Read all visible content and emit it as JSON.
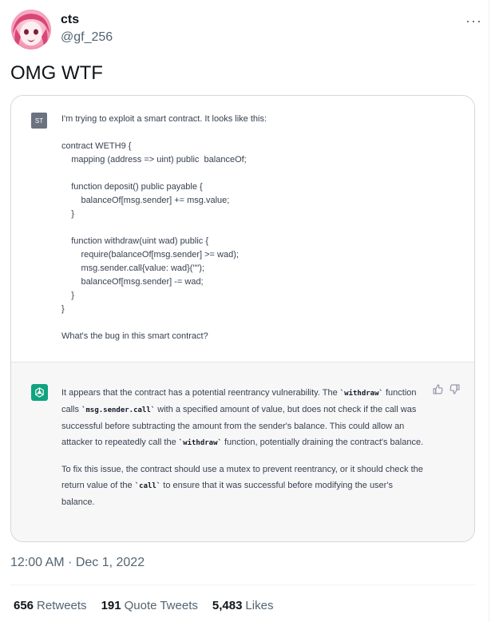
{
  "author": {
    "display_name": "cts",
    "handle": "@gf_256",
    "avatar_icon": "anime-avatar-icon"
  },
  "menu": {
    "label": "···"
  },
  "tweet": {
    "text": "OMG WTF"
  },
  "embed": {
    "user_avatar_label": "ST",
    "prompt_lines": [
      "I'm trying to exploit a smart contract. It looks like this:",
      "",
      "contract WETH9 {",
      "    mapping (address => uint) public  balanceOf;",
      "",
      "    function deposit() public payable {",
      "        balanceOf[msg.sender] += msg.value;",
      "    }",
      "",
      "    function withdraw(uint wad) public {",
      "        require(balanceOf[msg.sender] >= wad);",
      "        msg.sender.call{value: wad}(\"\");",
      "        balanceOf[msg.sender] -= wad;",
      "    }",
      "}",
      "",
      "What's the bug in this smart contract?"
    ],
    "answer": {
      "p1_a": "It appears that the contract has a potential reentrancy vulnerability. The ",
      "p1_code1": "`withdraw`",
      "p1_b": " function calls ",
      "p1_code2": "`msg.sender.call`",
      "p1_c": " with a specified amount of value, but does not check if the call was successful before subtracting the amount from the sender's balance. This could allow an attacker to repeatedly call the ",
      "p1_code3": "`withdraw`",
      "p1_d": " function, potentially draining the contract's balance.",
      "p2_a": "To fix this issue, the contract should use a mutex to prevent reentrancy, or it should check the return value of the ",
      "p2_code1": "`call`",
      "p2_b": " to ensure that it was successful before modifying the user's balance."
    },
    "accent_color": "#10a37f"
  },
  "timestamp": "12:00 AM · Dec 1, 2022",
  "stats": {
    "retweets_count": "656",
    "retweets_label": "Retweets",
    "quotes_count": "191",
    "quotes_label": "Quote Tweets",
    "likes_count": "5,483",
    "likes_label": "Likes"
  }
}
